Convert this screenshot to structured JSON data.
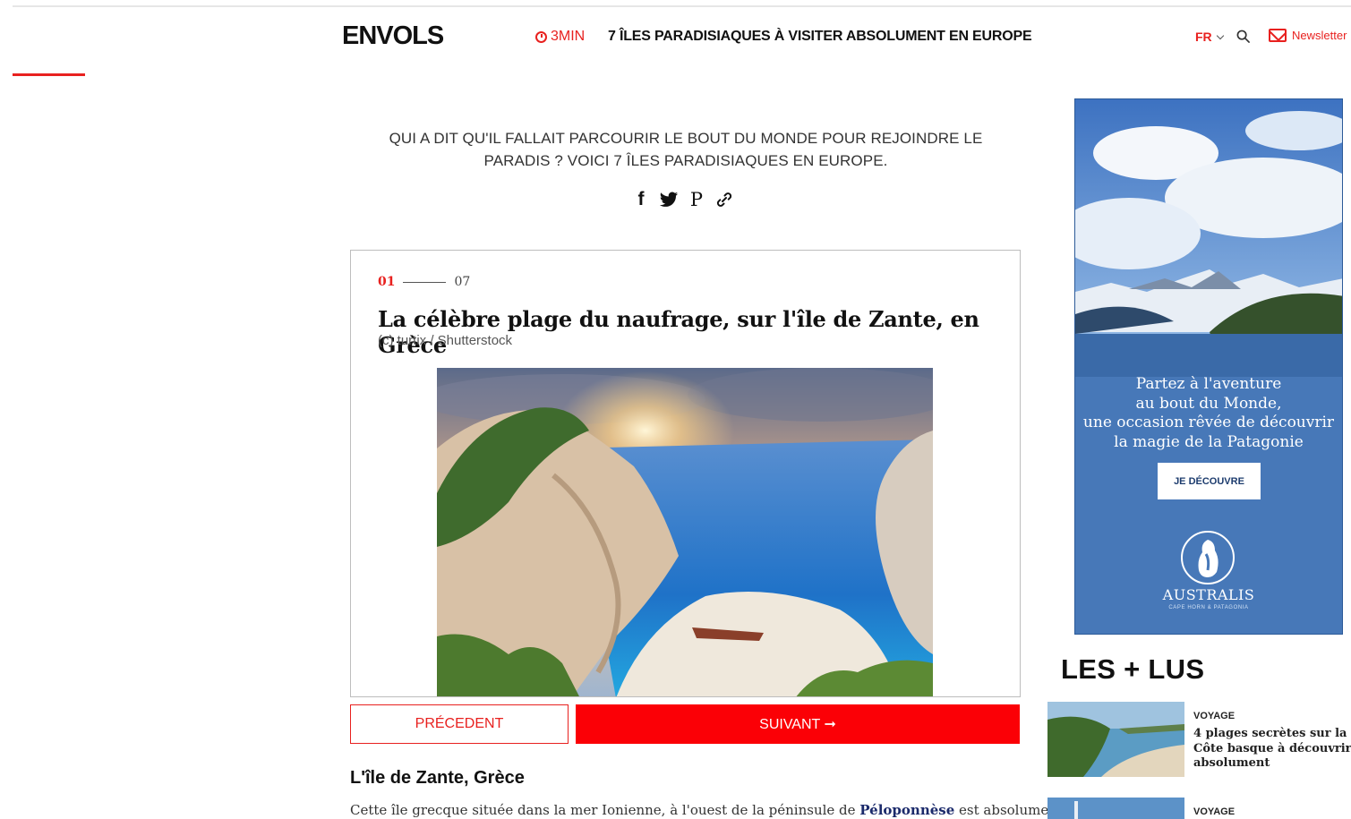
{
  "header": {
    "logo": "ENVOLS",
    "read_time": "3MIN",
    "title": "7 ÎLES PARADISIAQUES À VISITER ABSOLUMENT EN EUROPE",
    "lang": "FR",
    "newsletter": "Newsletter"
  },
  "intro": {
    "text": "QUI A DIT QU'IL FALLAIT PARCOURIR LE BOUT DU MONDE POUR REJOINDRE LE PARADIS ? VOICI 7 ÎLES PARADISIAQUES EN EUROPE."
  },
  "share": {
    "icons": [
      "facebook-icon",
      "twitter-icon",
      "pinterest-icon",
      "link-icon"
    ],
    "facebook": "f",
    "pinterest": "P"
  },
  "slide": {
    "current": "01",
    "total": "07",
    "title": "La célèbre plage du naufrage, sur l'île de Zante, en Grèce",
    "credit": "(c) turtix / Shutterstock"
  },
  "nav": {
    "prev": "PRÉCEDENT",
    "next": "SUIVANT ➞"
  },
  "article": {
    "section_title": "L'île de Zante, Grèce",
    "body_before": "Cette île grecque située dans la mer Ionienne, à l'ouest de la péninsule de ",
    "body_link": "Péloponnèse",
    "body_after": " est absolument"
  },
  "ad": {
    "line1": "Partez à l'aventure",
    "line2": "au bout du Monde,",
    "line3": "une occasion rêvée de découvrir",
    "line4": "la magie de la Patagonie",
    "button": "JE DÉCOUVRE",
    "brand": "AUSTRALIS",
    "brand_sub": "CAPE HORN & PATAGONIA"
  },
  "most_read": {
    "title": "LES + LUS",
    "items": [
      {
        "category": "VOYAGE",
        "headline": "4 plages secrètes sur la Côte basque à découvrir absolument"
      },
      {
        "category": "VOYAGE",
        "headline": ""
      }
    ]
  },
  "colors": {
    "accent": "#e8211f",
    "next_button": "#fb0006",
    "ad_blue": "#4778b8"
  }
}
